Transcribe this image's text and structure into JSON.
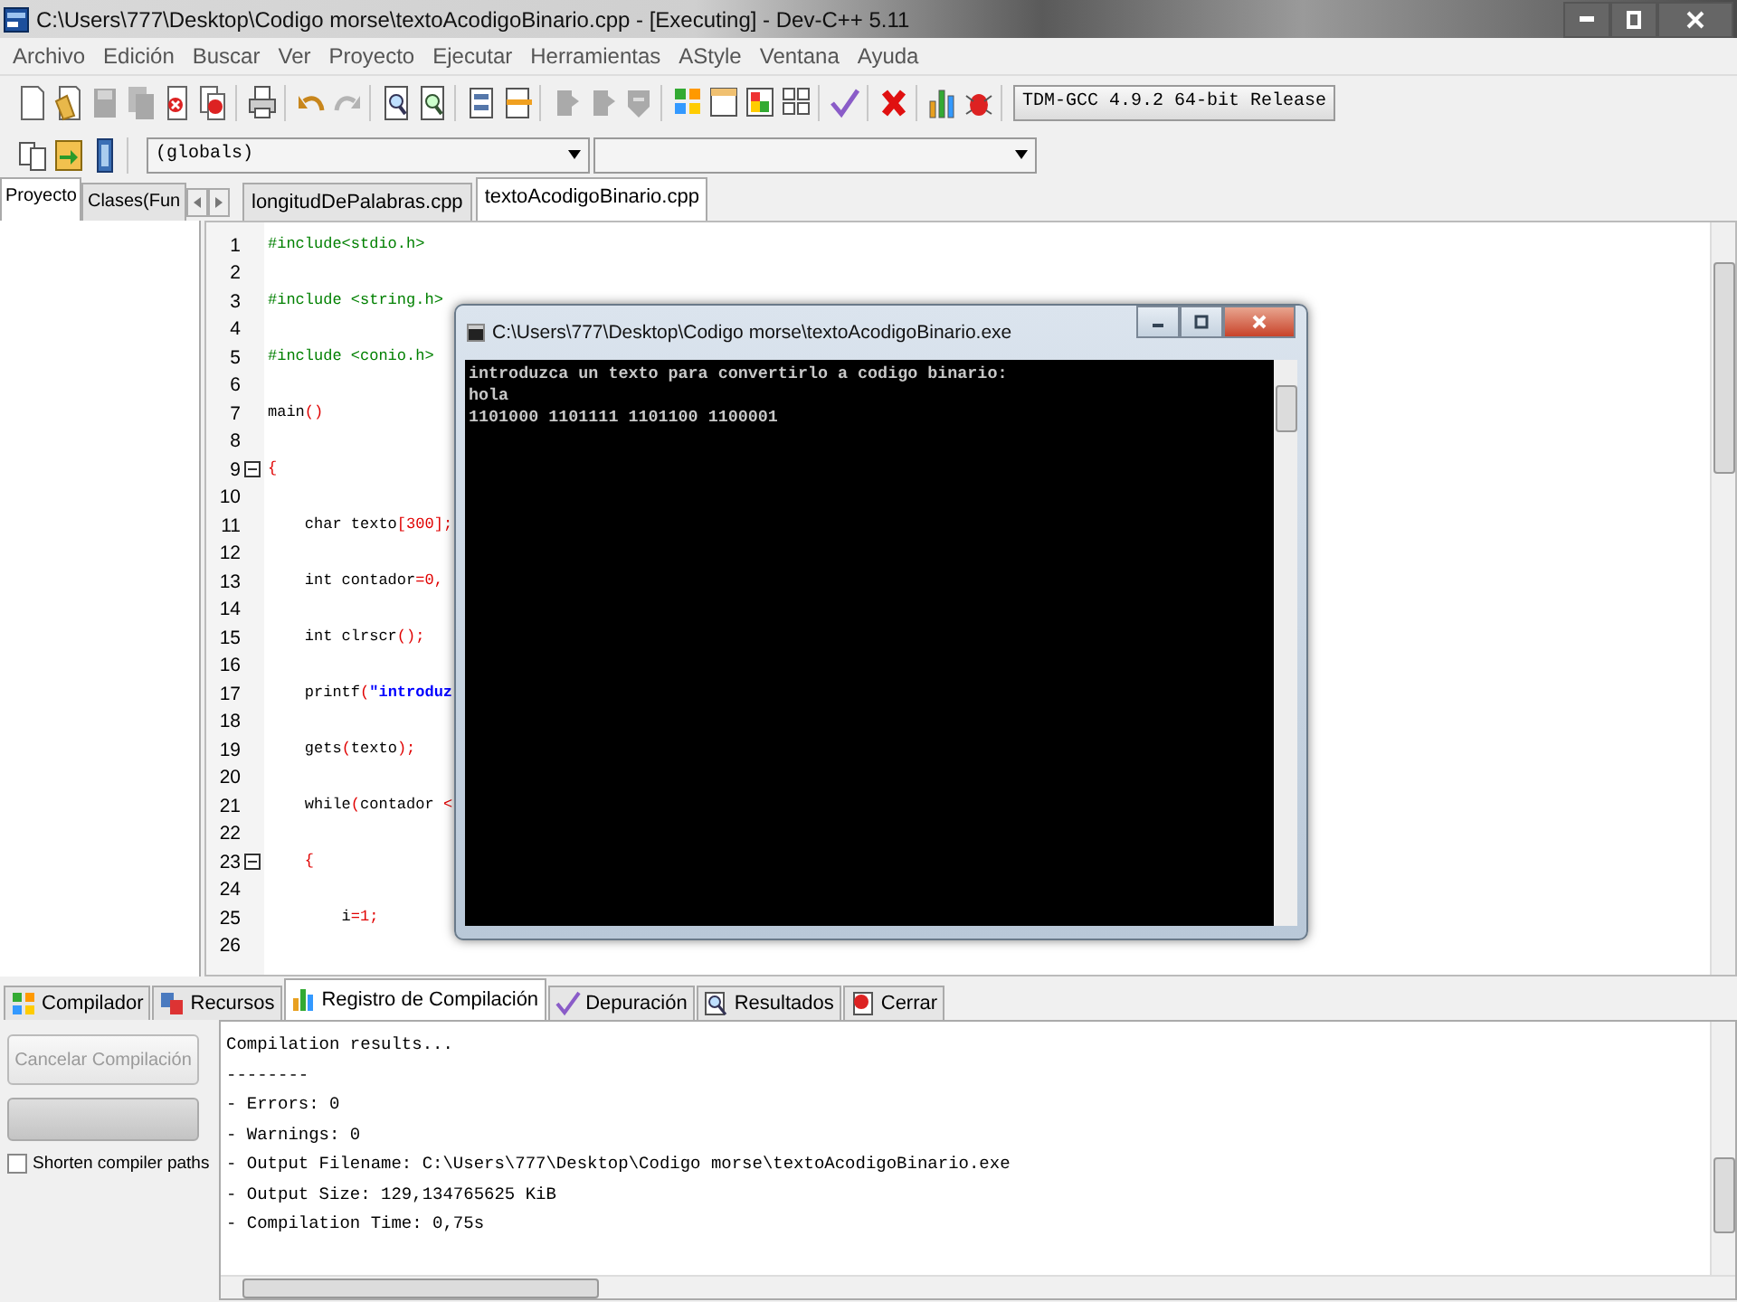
{
  "title_bar": {
    "title": "C:\\Users\\777\\Desktop\\Codigo morse\\textoAcodigoBinario.cpp - [Executing] - Dev-C++ 5.11"
  },
  "menu": [
    "Archivo",
    "Edición",
    "Buscar",
    "Ver",
    "Proyecto",
    "Ejecutar",
    "Herramientas",
    "AStyle",
    "Ventana",
    "Ayuda"
  ],
  "toolbar": {
    "compiler": "TDM-GCC 4.9.2 64-bit Release"
  },
  "scope_bar": {
    "scope": "(globals)"
  },
  "left_tabs": [
    {
      "label": "Proyecto",
      "selected": true
    },
    {
      "label": "Clases(Fun",
      "selected": false
    }
  ],
  "editor_tabs": [
    {
      "label": "longitudDePalabras.cpp",
      "selected": false
    },
    {
      "label": "textoAcodigoBinario.cpp",
      "selected": true
    }
  ],
  "editor": {
    "lines": [
      {
        "number": "1",
        "fold": false,
        "segments": [
          {
            "text": "#include<stdio.h>",
            "kind": "directive"
          }
        ]
      },
      {
        "number": "2",
        "fold": false
      },
      {
        "number": "3",
        "fold": false,
        "segments": [
          {
            "text": "#include <string.h>",
            "kind": "directive"
          }
        ]
      },
      {
        "number": "4",
        "fold": false
      },
      {
        "number": "5",
        "fold": false,
        "segments": [
          {
            "text": "#include <conio.h>",
            "kind": "directive"
          }
        ]
      },
      {
        "number": "6",
        "fold": false
      },
      {
        "number": "7",
        "fold": false,
        "segments": [
          {
            "text": "main",
            "kind": "plain"
          },
          {
            "text": "()",
            "kind": "symbol"
          }
        ]
      },
      {
        "number": "8",
        "fold": false
      },
      {
        "number": "9",
        "fold": true,
        "segments": [
          {
            "text": "{",
            "kind": "symbol"
          }
        ]
      },
      {
        "number": "10",
        "fold": false
      },
      {
        "number": "11",
        "fold": false,
        "segments": [
          {
            "text": "    char texto",
            "kind": "plain"
          },
          {
            "text": "[",
            "kind": "symbol"
          },
          {
            "text": "300",
            "kind": "number"
          },
          {
            "text": "];",
            "kind": "symbol"
          }
        ]
      },
      {
        "number": "12",
        "fold": false
      },
      {
        "number": "13",
        "fold": false,
        "segments": [
          {
            "text": "    int contador",
            "kind": "plain"
          },
          {
            "text": "=",
            "kind": "symbol"
          },
          {
            "text": "0",
            "kind": "number"
          },
          {
            "text": ",",
            "kind": "symbol"
          }
        ]
      },
      {
        "number": "14",
        "fold": false
      },
      {
        "number": "15",
        "fold": false,
        "segments": [
          {
            "text": "    int clrscr",
            "kind": "plain"
          },
          {
            "text": "();",
            "kind": "symbol"
          }
        ]
      },
      {
        "number": "16",
        "fold": false
      },
      {
        "number": "17",
        "fold": false,
        "segments": [
          {
            "text": "    printf",
            "kind": "plain"
          },
          {
            "text": "(",
            "kind": "symbol"
          },
          {
            "text": "\"introduz",
            "kind": "string"
          }
        ]
      },
      {
        "number": "18",
        "fold": false
      },
      {
        "number": "19",
        "fold": false,
        "segments": [
          {
            "text": "    gets",
            "kind": "plain"
          },
          {
            "text": "(",
            "kind": "symbol"
          },
          {
            "text": "texto",
            "kind": "plain"
          },
          {
            "text": ");",
            "kind": "symbol"
          }
        ]
      },
      {
        "number": "20",
        "fold": false
      },
      {
        "number": "21",
        "fold": false,
        "segments": [
          {
            "text": "    while",
            "kind": "plain"
          },
          {
            "text": "(",
            "kind": "symbol"
          },
          {
            "text": "contador ",
            "kind": "plain"
          },
          {
            "text": "<",
            "kind": "symbol"
          }
        ]
      },
      {
        "number": "22",
        "fold": false
      },
      {
        "number": "23",
        "fold": true,
        "segments": [
          {
            "text": "    {",
            "kind": "symbol"
          }
        ]
      },
      {
        "number": "24",
        "fold": false
      },
      {
        "number": "25",
        "fold": false,
        "segments": [
          {
            "text": "        i",
            "kind": "plain"
          },
          {
            "text": "=",
            "kind": "symbol"
          },
          {
            "text": "1",
            "kind": "number"
          },
          {
            "text": ";",
            "kind": "symbol"
          }
        ]
      },
      {
        "number": "26",
        "fold": false
      }
    ]
  },
  "console": {
    "title": "C:\\Users\\777\\Desktop\\Codigo morse\\textoAcodigoBinario.exe",
    "lines": [
      "introduzca un texto para convertirlo a codigo binario:",
      "hola",
      "1101000 1101111 1101100 1100001"
    ]
  },
  "bottom_tabs": [
    {
      "label": "Compilador",
      "selected": false
    },
    {
      "label": "Recursos",
      "selected": false
    },
    {
      "label": "Registro de Compilación",
      "selected": true
    },
    {
      "label": "Depuración",
      "selected": false
    },
    {
      "label": "Resultados",
      "selected": false
    },
    {
      "label": "Cerrar",
      "selected": false
    }
  ],
  "compile_panel": {
    "cancel_button": {
      "label": "Cancelar Compilación",
      "disabled": true
    },
    "progress": {
      "level": 0
    },
    "shorten_paths": {
      "label": "Shorten compiler paths",
      "checked": false
    }
  },
  "log": {
    "lines": [
      "Compilation results...",
      "--------",
      "- Errors: 0",
      "- Warnings: 0",
      "- Output Filename: C:\\Users\\777\\Desktop\\Codigo morse\\textoAcodigoBinario.exe",
      "- Output Size: 129,134765625 KiB",
      "- Compilation Time: 0,75s"
    ]
  }
}
